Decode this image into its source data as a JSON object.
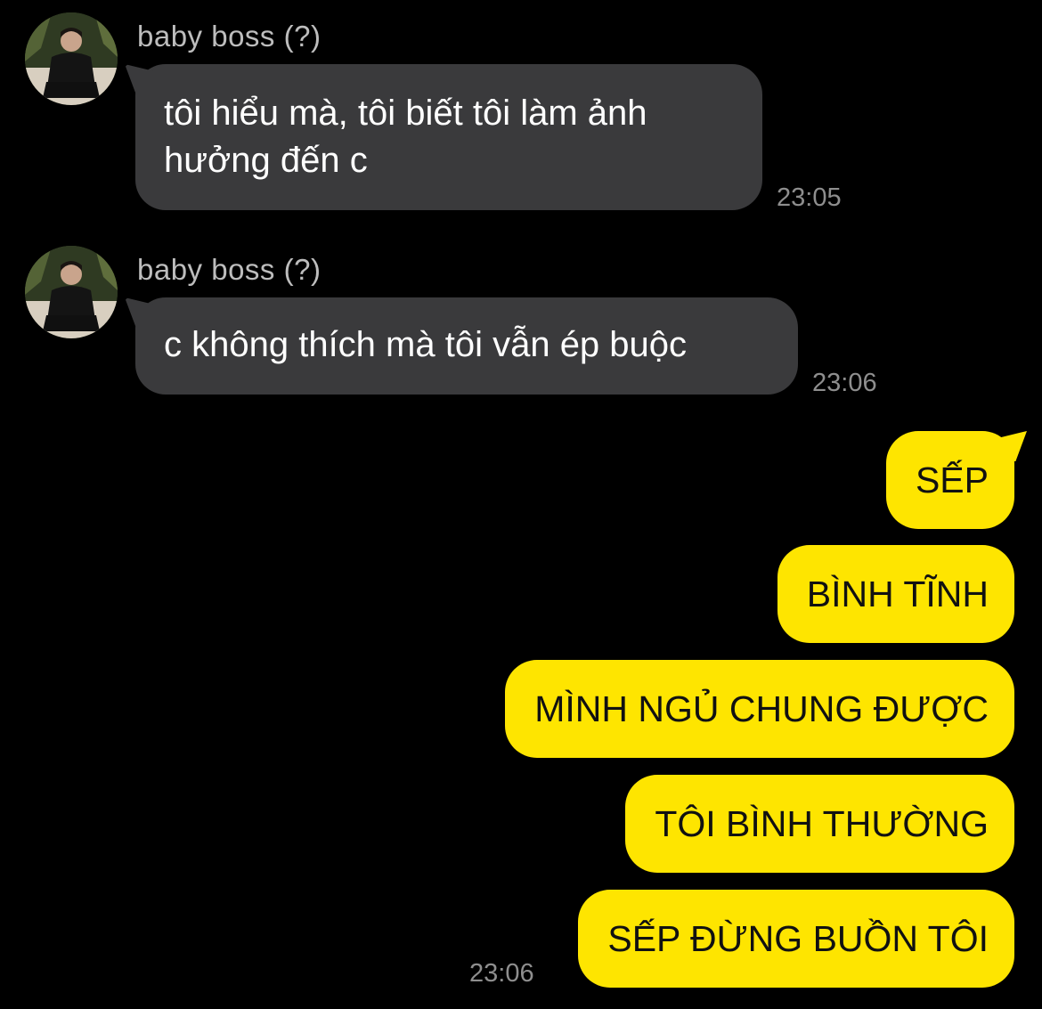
{
  "conversation": {
    "messages": [
      {
        "sender": "baby boss (?)",
        "text_line1": "tôi hiểu mà, tôi biết tôi làm ảnh",
        "text_line2": "hưởng đến c",
        "time": "23:05"
      },
      {
        "sender": "baby boss (?)",
        "text_line1": "c không thích mà tôi vẫn ép buộc",
        "time": "23:06"
      }
    ],
    "outgoing": [
      {
        "text": "SẾP"
      },
      {
        "text": "BÌNH TĨNH"
      },
      {
        "text": "MÌNH NGỦ CHUNG ĐƯỢC"
      },
      {
        "text": "TÔI BÌNH THƯỜNG"
      },
      {
        "text": "SẾP ĐỪNG BUỒN TÔI"
      }
    ],
    "outgoing_time": "23:06"
  },
  "colors": {
    "background": "#000000",
    "incoming_bubble": "#3a3a3c",
    "outgoing_bubble": "#fee500",
    "timestamp": "#8e8e8e",
    "sender_name": "#bdbdbd"
  },
  "icons": {
    "avatar": "profile-photo"
  }
}
